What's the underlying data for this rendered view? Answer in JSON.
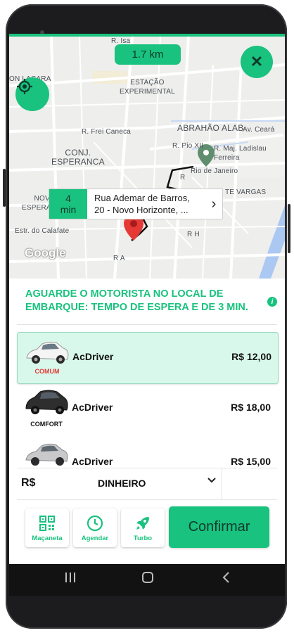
{
  "map": {
    "distance": "1.7 km",
    "labels": [
      "R. Isa",
      "ON LACARA",
      "ESTAÇÃO\nEXPERIMENTAL",
      "R. Frei Caneca",
      "ABRAHÃO ALAB",
      "Av. Ceará",
      "R. Pio XII",
      "R. Maj. Ladislau Ferreira",
      "CONJ.\nESPERANCA",
      "Rio de Janeiro",
      "NOVA\nESPERANÇA",
      "TE VARGAS",
      "Estr. do Calafate",
      "R H",
      "R A",
      "R"
    ],
    "google_label": "Google",
    "close_icon": "close-icon",
    "locate_icon": "gps-locate-icon"
  },
  "eta": {
    "minutes": "4",
    "unit": "min",
    "address_line1": "Rua Ademar de Barros,",
    "address_line2": "20 - Novo Horizonte, ..."
  },
  "notice": "AGUARDE O MOTORISTA NO LOCAL DE EMBARQUE: TEMPO DE ESPERA E DE 3 MIN.",
  "info_glyph": "i",
  "options": [
    {
      "name": "AcDriver",
      "price": "R$ 12,00",
      "tag": "COMUM",
      "selected": true
    },
    {
      "name": "AcDriver",
      "price": "R$ 18,00",
      "tag": "COMFORT",
      "selected": false
    },
    {
      "name": "AcDriver",
      "price": "R$ 15,00",
      "tag": "",
      "selected": false
    }
  ],
  "payment": {
    "currency": "R$",
    "method": "DINHEIRO"
  },
  "services": [
    {
      "label": "Maçaneta",
      "icon": "qr-code-icon"
    },
    {
      "label": "Agendar",
      "icon": "clock-icon"
    },
    {
      "label": "Turbo",
      "icon": "rocket-icon"
    }
  ],
  "confirm_label": "Confirmar",
  "colors": {
    "accent": "#19c27e",
    "selected_bg": "#d9f8ec"
  }
}
